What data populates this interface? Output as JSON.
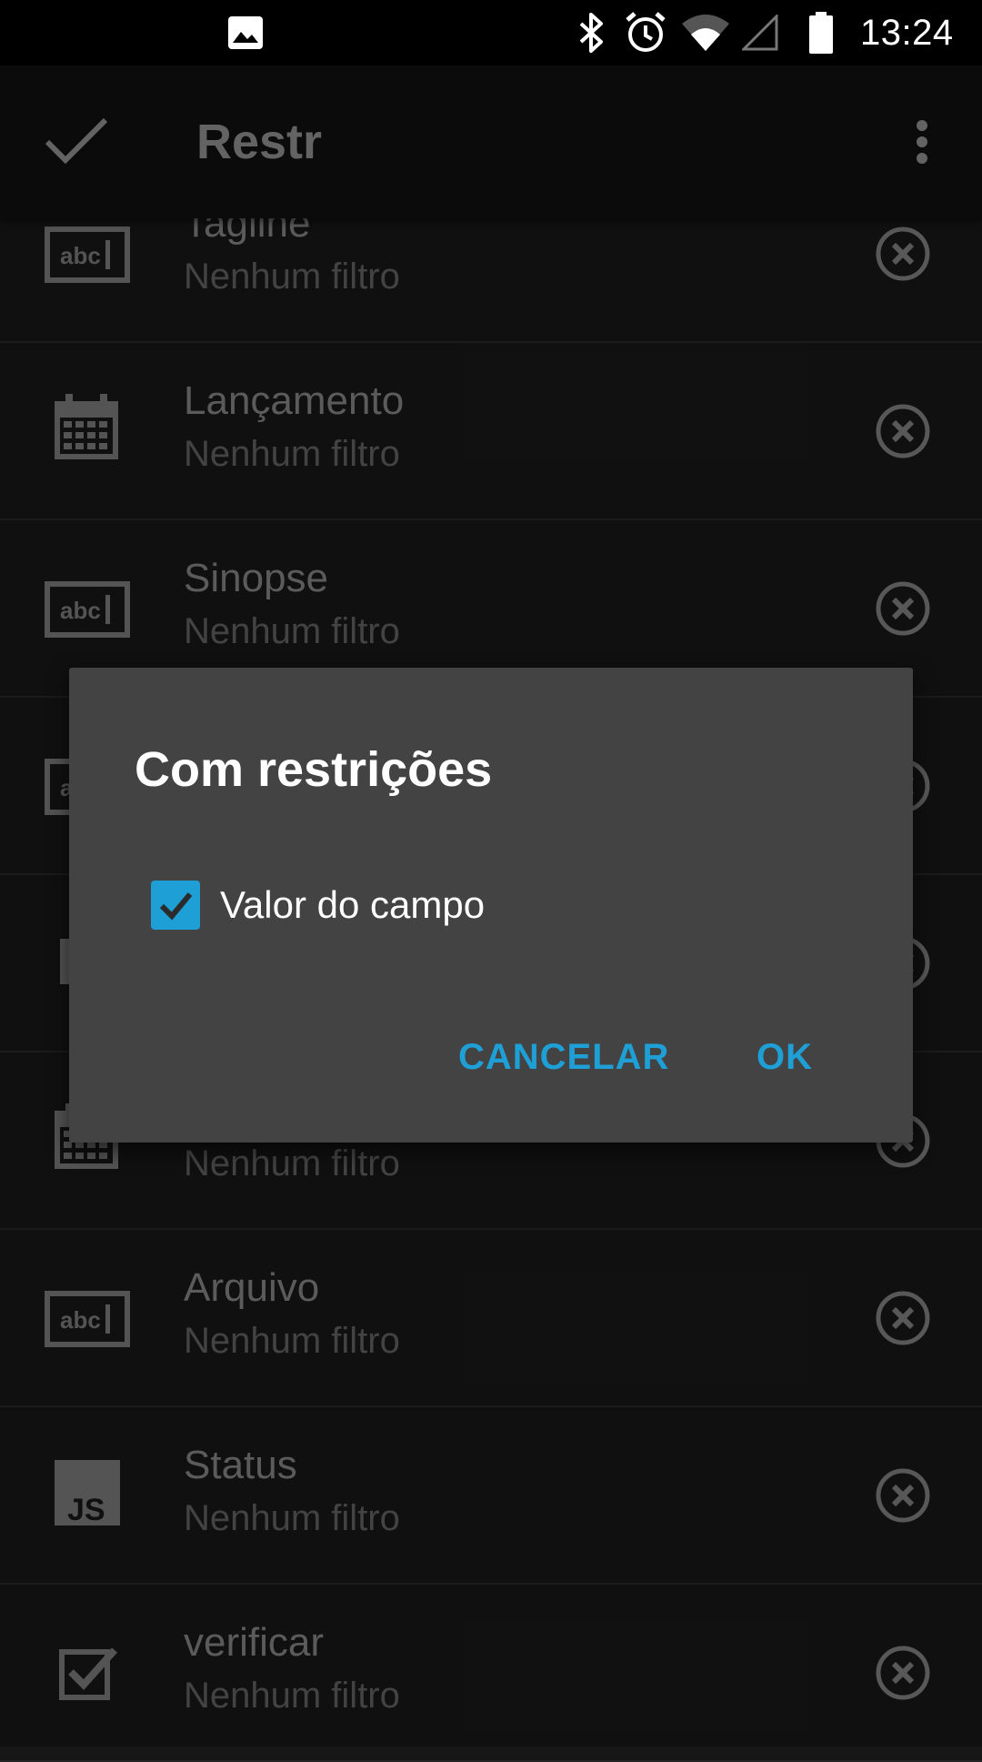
{
  "status_bar": {
    "time": "13:24",
    "icons": [
      "image-icon",
      "bluetooth-icon",
      "alarm-icon",
      "wifi-icon",
      "cell-signal-icon",
      "battery-icon"
    ]
  },
  "toolbar": {
    "title": "Restr",
    "confirm_icon": "check-icon",
    "menu_icon": "more-vert-icon"
  },
  "list": {
    "items": [
      {
        "title": "Tagline",
        "subtitle": "Nenhum filtro",
        "icon": "text-field-icon"
      },
      {
        "title": "Lançamento",
        "subtitle": "Nenhum filtro",
        "icon": "calendar-icon"
      },
      {
        "title": "Sinopse",
        "subtitle": "Nenhum filtro",
        "icon": "text-field-icon"
      },
      {
        "title": "",
        "subtitle": "",
        "icon": "text-field-icon"
      },
      {
        "title": "",
        "subtitle": "",
        "icon": "field-icon"
      },
      {
        "title": "",
        "subtitle": "Nenhum filtro",
        "icon": "calendar-icon"
      },
      {
        "title": "Arquivo",
        "subtitle": "Nenhum filtro",
        "icon": "text-field-icon"
      },
      {
        "title": "Status",
        "subtitle": "Nenhum filtro",
        "icon": "javascript-icon"
      },
      {
        "title": "verificar",
        "subtitle": "Nenhum filtro",
        "icon": "checkbox-icon"
      }
    ]
  },
  "dialog": {
    "title": "Com restrições",
    "option": {
      "label": "Valor do campo",
      "checked": true
    },
    "cancel_label": "CANCELAR",
    "ok_label": "OK"
  },
  "colors": {
    "accent": "#1e9fd6",
    "background": "#171717",
    "dialog": "#434343"
  }
}
